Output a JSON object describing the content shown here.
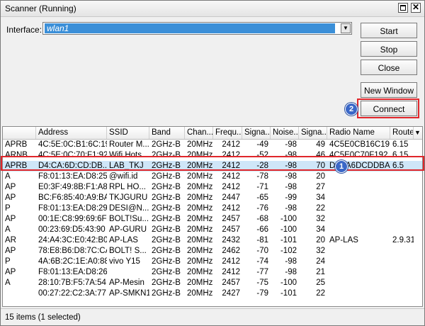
{
  "window": {
    "title": "Scanner (Running)"
  },
  "interface": {
    "label": "Interface:",
    "value": "wlan1"
  },
  "buttons": {
    "start": "Start",
    "stop": "Stop",
    "close": "Close",
    "new_window": "New Window",
    "connect": "Connect"
  },
  "badges": {
    "one": "1",
    "two": "2"
  },
  "accent_colors": {
    "highlight": "#e0262b",
    "badge": "#3a67c7",
    "selection": "#cfe6f8"
  },
  "table": {
    "columns": [
      "",
      "Address",
      "SSID",
      "Band",
      "Chan...",
      "Frequ...",
      "Signa...",
      "Noise...",
      "Signa...",
      "Radio Name",
      "Route"
    ],
    "rows": [
      [
        "APRB",
        "4C:5E:0C:B1:6C:19",
        "Router M...",
        "2GHz-B",
        "20MHz",
        "2412",
        "-49",
        "-98",
        "49",
        "4C5E0CB16C19",
        "6.15"
      ],
      [
        "ARNB",
        "4C:5E:0C:70:F1:92",
        "Wifi Hots...",
        "2GHz-B",
        "20MHz",
        "2412",
        "-52",
        "-98",
        "46",
        "4C5E0C70F192",
        "6.15"
      ],
      [
        "APRB",
        "D4:CA:6D:CD:DB...",
        "LAB_TKJ",
        "2GHz-B",
        "20MHz",
        "2412",
        "-28",
        "-98",
        "70",
        "D4CA6DCDDBA7",
        "6.5"
      ],
      [
        "A",
        "F8:01:13:EA:D8:25",
        "@wifi.id",
        "2GHz-B",
        "20MHz",
        "2412",
        "-78",
        "-98",
        "20",
        "",
        ""
      ],
      [
        "AP",
        "E0:3F:49:8B:F1:A8",
        "RPL HO...",
        "2GHz-B",
        "20MHz",
        "2412",
        "-71",
        "-98",
        "27",
        "",
        ""
      ],
      [
        "AP",
        "BC:F6:85:40:A9:BA",
        "TKJGURU",
        "2GHz-B",
        "20MHz",
        "2447",
        "-65",
        "-99",
        "34",
        "",
        ""
      ],
      [
        "P",
        "F8:01:13:EA:D8:29",
        "DESI@N...",
        "2GHz-B",
        "20MHz",
        "2412",
        "-76",
        "-98",
        "22",
        "",
        ""
      ],
      [
        "AP",
        "00:1E:C8:99:69:6F",
        "BOLT!Su...",
        "2GHz-B",
        "20MHz",
        "2457",
        "-68",
        "-100",
        "32",
        "",
        ""
      ],
      [
        "A",
        "00:23:69:D5:43:90",
        "AP-GURU",
        "2GHz-B",
        "20MHz",
        "2457",
        "-66",
        "-100",
        "34",
        "",
        ""
      ],
      [
        "AR",
        "24:A4:3C:E0:42:B0",
        "AP-LAS",
        "2GHz-B",
        "20MHz",
        "2432",
        "-81",
        "-101",
        "20",
        "AP-LAS",
        "2.9.31"
      ],
      [
        "AP",
        "78:E8:B6:D8:7C:CA",
        "BOLT! S...",
        "2GHz-B",
        "20MHz",
        "2462",
        "-70",
        "-102",
        "32",
        "",
        ""
      ],
      [
        "P",
        "4A:6B:2C:1E:A0:88",
        "vivo Y15",
        "2GHz-B",
        "20MHz",
        "2412",
        "-74",
        "-98",
        "24",
        "",
        ""
      ],
      [
        "AP",
        "F8:01:13:EA:D8:26",
        "",
        "2GHz-B",
        "20MHz",
        "2412",
        "-77",
        "-98",
        "21",
        "",
        ""
      ],
      [
        "A",
        "28:10:7B:F5:7A:54",
        "AP-Mesin",
        "2GHz-B",
        "20MHz",
        "2457",
        "-75",
        "-100",
        "25",
        "",
        ""
      ],
      [
        "",
        "00:27:22:C2:3A:77",
        "AP-SMKN1",
        "2GHz-B",
        "20MHz",
        "2427",
        "-79",
        "-101",
        "22",
        "",
        ""
      ]
    ]
  },
  "status": {
    "text": "15 items (1 selected)"
  }
}
